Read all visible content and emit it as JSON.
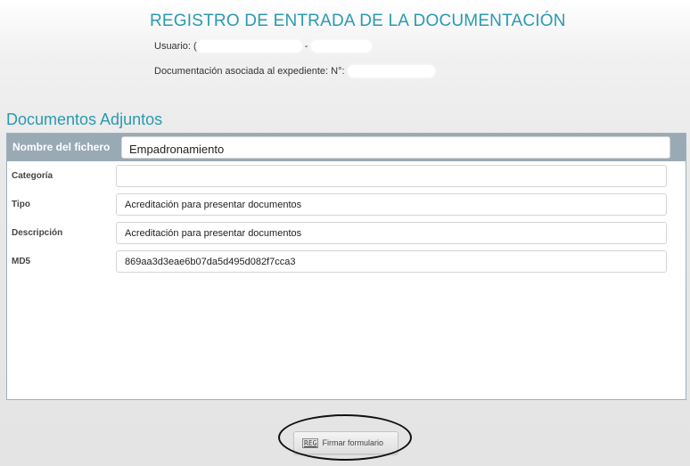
{
  "header": {
    "title": "REGISTRO DE ENTRADA DE LA DOCUMENTACIÓN",
    "usuario_label": "Usuario:",
    "usuario_prefix": "(",
    "usuario_sep": "-",
    "expediente_label": "Documentación asociada al expediente: N°:"
  },
  "section": {
    "title": "Documentos Adjuntos"
  },
  "file": {
    "name_label": "Nombre del fichero",
    "name_value": "Empadronamiento"
  },
  "fields": [
    {
      "label": "Categoría",
      "value": ""
    },
    {
      "label": "Tipo",
      "value": "Acreditación para presentar documentos"
    },
    {
      "label": "Descripción",
      "value": "Acreditación para presentar documentos"
    },
    {
      "label": "MD5",
      "value": "869aa3d3eae6b07da5d495d082f7cca3"
    }
  ],
  "actions": {
    "sign_label": "Firmar formulario",
    "sign_icon": "REG"
  },
  "colors": {
    "accent": "#2a9ab0",
    "panel_header": "#9aaab5"
  }
}
